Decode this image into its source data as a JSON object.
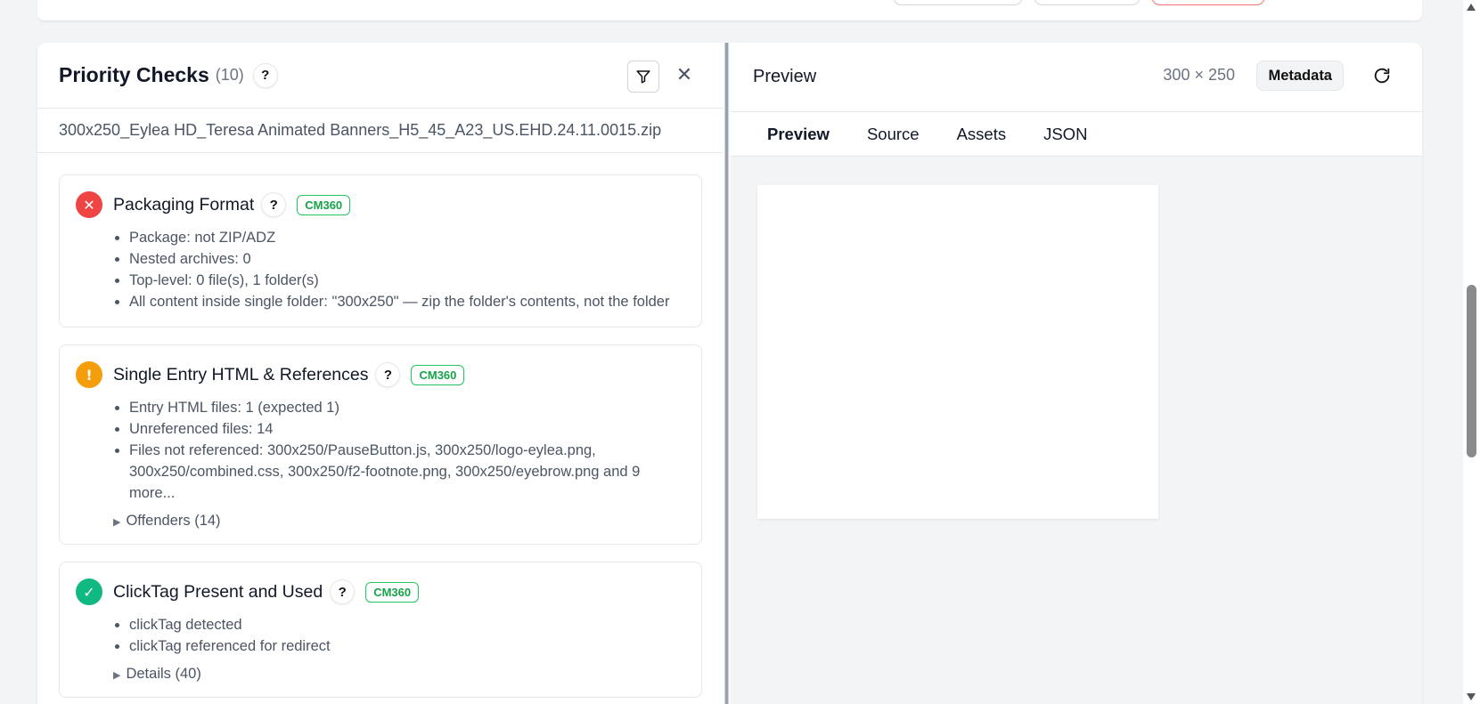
{
  "left_panel": {
    "title": "Priority Checks",
    "count": "(10)",
    "help": "?",
    "close": "✕",
    "filename": "300x250_Eylea HD_Teresa Animated Banners_H5_45_A23_US.EHD.24.11.0015.zip",
    "checks": [
      {
        "status": "fail",
        "status_icon": "✕",
        "title": "Packaging Format",
        "help": "?",
        "badge": "CM360",
        "items": [
          "Package: not ZIP/ADZ",
          "Nested archives: 0",
          "Top-level: 0 file(s), 1 folder(s)",
          "All content inside single folder: \"300x250\" — zip the folder's contents, not the folder"
        ]
      },
      {
        "status": "warn",
        "status_icon": "!",
        "title": "Single Entry HTML & References",
        "help": "?",
        "badge": "CM360",
        "items": [
          "Entry HTML files: 1 (expected 1)",
          "Unreferenced files: 14",
          "Files not referenced: 300x250/PauseButton.js, 300x250/logo-eylea.png, 300x250/combined.css, 300x250/f2-footnote.png, 300x250/eyebrow.png and 9 more..."
        ],
        "details": "Offenders (14)"
      },
      {
        "status": "pass",
        "status_icon": "✓",
        "title": "ClickTag Present and Used",
        "help": "?",
        "badge": "CM360",
        "items": [
          "clickTag detected",
          "clickTag referenced for redirect"
        ],
        "details": "Details (40)"
      }
    ]
  },
  "right_panel": {
    "title": "Preview",
    "dimensions": "300 × 250",
    "metadata_label": "Metadata",
    "tabs": [
      {
        "label": "Preview",
        "active": true
      },
      {
        "label": "Source",
        "active": false
      },
      {
        "label": "Assets",
        "active": false
      },
      {
        "label": "JSON",
        "active": false
      }
    ]
  },
  "icons": {
    "filter": "filter-icon",
    "close": "close-icon",
    "refresh": "refresh-icon"
  },
  "colors": {
    "fail": "#ef4444",
    "warn": "#f59e0b",
    "pass": "#10b981",
    "badge": "#16a34a"
  }
}
